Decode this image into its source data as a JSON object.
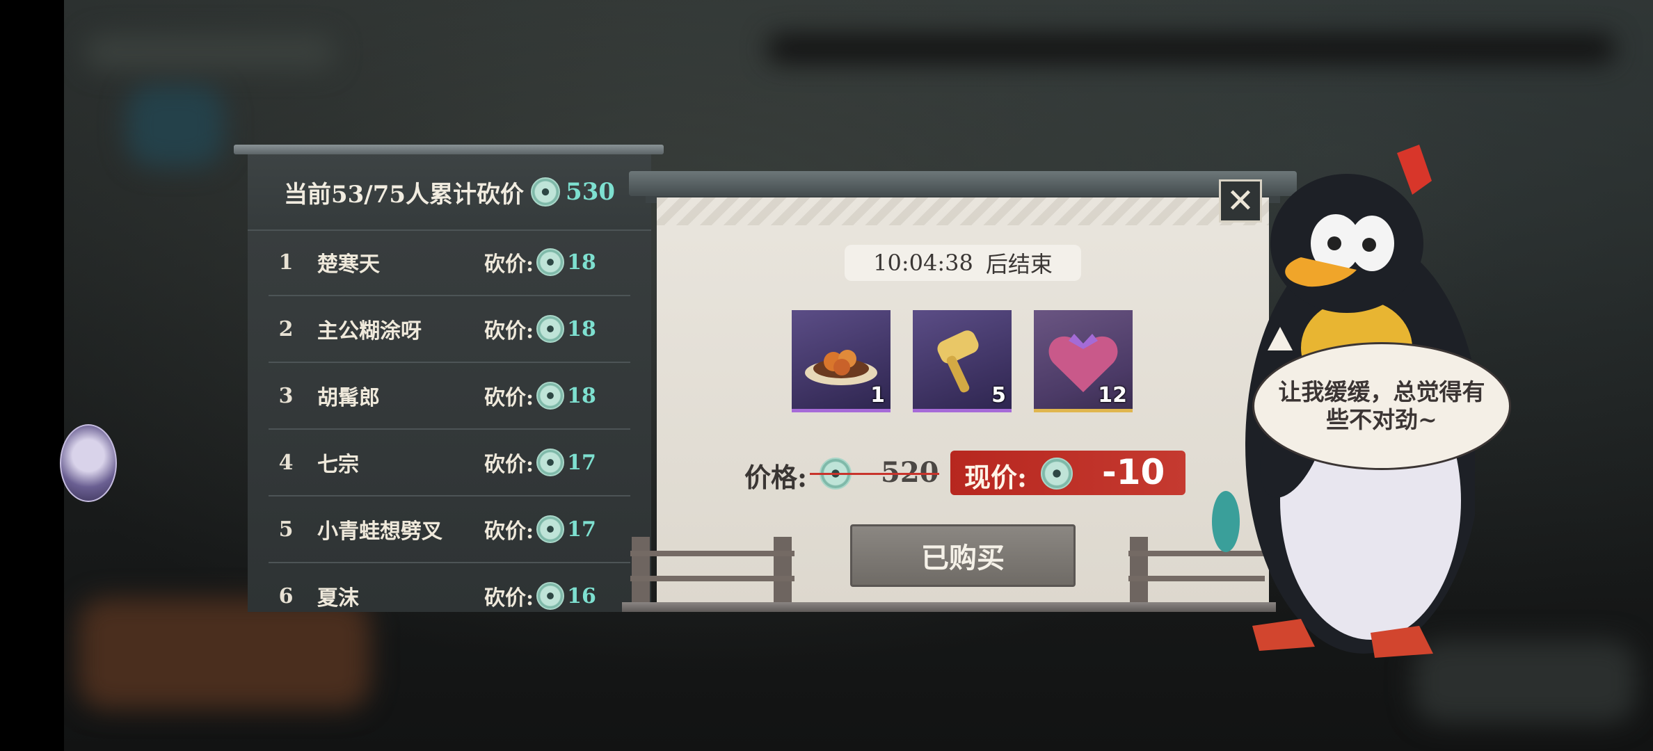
{
  "ranking": {
    "header_text": "当前53/75人累计砍价",
    "total": "530",
    "rows": [
      {
        "rank": "1",
        "name": "楚寒天",
        "label": "砍价:",
        "value": "18"
      },
      {
        "rank": "2",
        "name": "主公糊涂呀",
        "label": "砍价:",
        "value": "18"
      },
      {
        "rank": "3",
        "name": "胡髯郎",
        "label": "砍价:",
        "value": "18"
      },
      {
        "rank": "4",
        "name": "七宗",
        "label": "砍价:",
        "value": "17"
      },
      {
        "rank": "5",
        "name": "小青蛙想劈叉",
        "label": "砍价:",
        "value": "17"
      },
      {
        "rank": "6",
        "name": "夏沫",
        "label": "砍价:",
        "value": "16"
      }
    ]
  },
  "shop": {
    "timer": "10:04:38",
    "timer_suffix": "后结束",
    "items": [
      {
        "icon": "food-dish-icon",
        "count": "1"
      },
      {
        "icon": "golden-hammer-icon",
        "count": "5"
      },
      {
        "icon": "heart-gift-box-icon",
        "count": "12"
      }
    ],
    "price_label": "价格:",
    "old_price": "520",
    "now_label": "现价:",
    "now_price": "-10",
    "buy_label": "已购买"
  },
  "speech": "让我缓缓，总觉得有些不对劲~",
  "colors": {
    "accent_teal": "#7ee0d0",
    "price_red": "#c53a30",
    "rarity_purple": "#a66bd8",
    "rarity_gold": "#e0b64e"
  }
}
